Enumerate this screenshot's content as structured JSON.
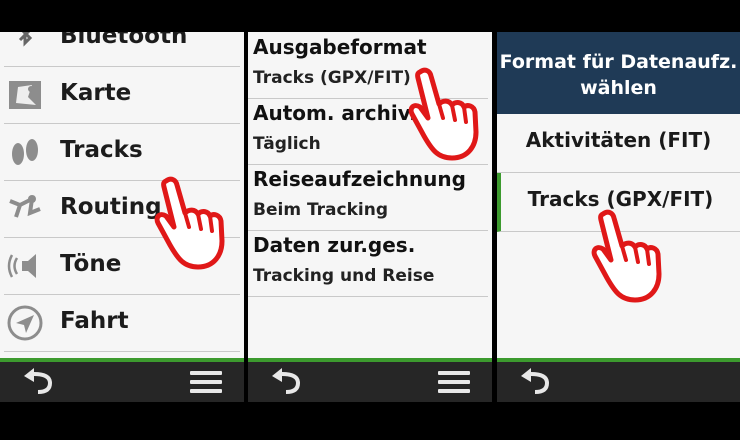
{
  "panel1": {
    "items": [
      {
        "label": "Bluetooth",
        "icon": "bluetooth-icon"
      },
      {
        "label": "Karte",
        "icon": "map-icon"
      },
      {
        "label": "Tracks",
        "icon": "footprints-icon"
      },
      {
        "label": "Routing",
        "icon": "routing-icon"
      },
      {
        "label": "Töne",
        "icon": "speaker-icon"
      },
      {
        "label": "Fahrt",
        "icon": "compass-arrow-icon"
      }
    ]
  },
  "panel2": {
    "items": [
      {
        "title": "Ausgabeformat",
        "value": "Tracks (GPX/FIT)"
      },
      {
        "title": "Autom. archiv.",
        "value": "Täglich"
      },
      {
        "title": "Reiseaufzeichnung",
        "value": "Beim Tracking"
      },
      {
        "title": "Daten zur.ges.",
        "value": "Tracking und Reise"
      }
    ]
  },
  "panel3": {
    "header_line1": "Format für Datenaufz.",
    "header_line2": "wählen",
    "options": [
      {
        "label": "Aktivitäten (FIT)",
        "selected": false
      },
      {
        "label": "Tracks (GPX/FIT)",
        "selected": true
      }
    ]
  },
  "colors": {
    "accent_green": "#3c9a2e",
    "header_blue": "#1f3a56",
    "hand_red": "#e01818"
  },
  "icons": {
    "back": "back-arrow-icon",
    "menu": "hamburger-menu-icon",
    "pointer": "pointing-hand-icon"
  }
}
